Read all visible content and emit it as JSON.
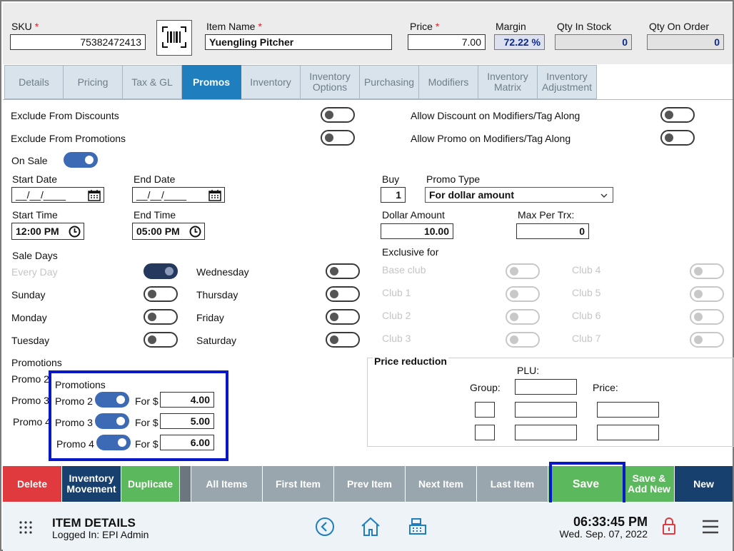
{
  "header": {
    "sku_label": "SKU",
    "sku_value": "75382472413",
    "item_name_label": "Item Name",
    "item_name_value": "Yuengling Pitcher",
    "price_label": "Price",
    "price_value": "7.00",
    "margin_label": "Margin",
    "margin_value": "72.22 %",
    "qty_in_stock_label": "Qty In Stock",
    "qty_in_stock_value": "0",
    "qty_on_order_label": "Qty On Order",
    "qty_on_order_value": "0",
    "required_mark": "*"
  },
  "tabs": [
    {
      "label": "Details",
      "active": false
    },
    {
      "label": "Pricing",
      "active": false
    },
    {
      "label": "Tax & GL",
      "active": false
    },
    {
      "label": "Promos",
      "active": true
    },
    {
      "label": "Inventory",
      "active": false
    },
    {
      "label": "Inventory Options",
      "active": false
    },
    {
      "label": "Purchasing",
      "active": false
    },
    {
      "label": "Modifiers",
      "active": false
    },
    {
      "label": "Inventory Matrix",
      "active": false
    },
    {
      "label": "Inventory Adjustment",
      "active": false
    }
  ],
  "promos": {
    "exclude_discounts": "Exclude From Discounts",
    "exclude_promotions": "Exclude From Promotions",
    "allow_discount_modifiers": "Allow Discount on Modifiers/Tag Along",
    "allow_promo_modifiers": "Allow Promo on Modifiers/Tag Along",
    "on_sale": "On Sale",
    "start_date_label": "Start Date",
    "start_date_value": "__/__/____",
    "end_date_label": "End Date",
    "end_date_value": "__/__/____",
    "start_time_label": "Start Time",
    "start_time_value": "12:00 PM",
    "end_time_label": "End Time",
    "end_time_value": "05:00 PM",
    "sale_days_label": "Sale Days",
    "every_day": "Every Day",
    "sunday": "Sunday",
    "monday": "Monday",
    "tuesday": "Tuesday",
    "wednesday": "Wednesday",
    "thursday": "Thursday",
    "friday": "Friday",
    "saturday": "Saturday",
    "buy_label": "Buy",
    "buy_value": "1",
    "promo_type_label": "Promo Type",
    "promo_type_value": "For dollar amount",
    "dollar_amount_label": "Dollar Amount",
    "dollar_amount_value": "10.00",
    "max_per_trx_label": "Max Per Trx:",
    "max_per_trx_value": "0",
    "exclusive_for_label": "Exclusive for",
    "clubs": [
      "Base club",
      "Club 1",
      "Club 2",
      "Club 3",
      "Club 4",
      "Club 5",
      "Club 6",
      "Club 7"
    ],
    "promotions_label": "Promotions",
    "promo_list_bg": [
      "Promo 2",
      "Promo 3",
      "Promo 4"
    ],
    "promo_rows": [
      {
        "name": "Promo 2",
        "for_label": "For $",
        "value": "4.00"
      },
      {
        "name": "Promo 3",
        "for_label": "For $",
        "value": "5.00"
      },
      {
        "name": "Promo 4",
        "for_label": "For $",
        "value": "6.00"
      }
    ],
    "price_reduction_label": "Price reduction",
    "plu_label": "PLU:",
    "group_label": "Group:",
    "price_label": "Price:"
  },
  "actions": {
    "delete": "Delete",
    "inventory_movement": "Inventory Movement",
    "duplicate": "Duplicate",
    "all_items": "All Items",
    "first_item": "First Item",
    "prev_item": "Prev Item",
    "next_item": "Next Item",
    "last_item": "Last Item",
    "save": "Save",
    "save_add_new": "Save & Add New",
    "new": "New"
  },
  "footer": {
    "title": "ITEM DETAILS",
    "logged_in": "Logged In:  EPI Admin",
    "time": "06:33:45 PM",
    "date": "Wed. Sep. 07, 2022"
  },
  "colors": {
    "tab_active": "#1f7fbe",
    "toggle_on": "#3d6ab5",
    "delete": "#e03a3e",
    "inventory_movement": "#18406e",
    "duplicate": "#5cb85c",
    "nav_gray": "#9aa6ae",
    "save": "#5cb85c",
    "new": "#18406e",
    "highlight": "#0818c6"
  }
}
